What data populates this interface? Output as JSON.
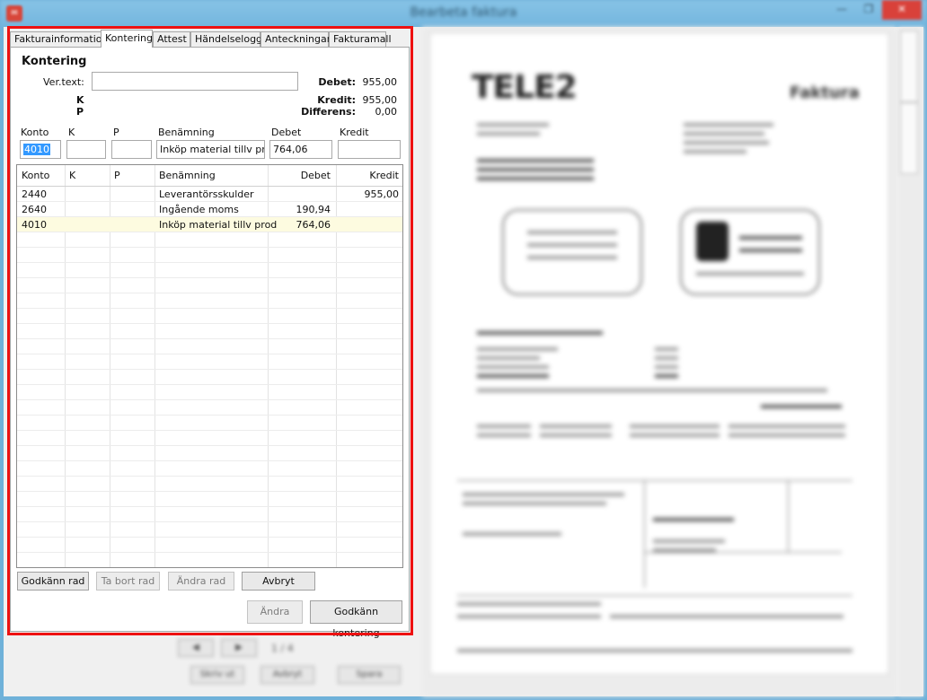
{
  "window": {
    "title": "Bearbeta faktura"
  },
  "tabs": [
    {
      "label": "Fakturainformation"
    },
    {
      "label": "Kontering"
    },
    {
      "label": "Attest"
    },
    {
      "label": "Händelselogg"
    },
    {
      "label": "Anteckningar"
    },
    {
      "label": "Fakturamall"
    }
  ],
  "kontering": {
    "heading": "Kontering",
    "vertext_label": "Ver.text:",
    "vertext_value": "",
    "k_label": "K",
    "p_label": "P",
    "debet_label": "Debet:",
    "debet_value": "955,00",
    "kredit_label": "Kredit:",
    "kredit_value": "955,00",
    "differens_label": "Differens:",
    "differens_value": "0,00"
  },
  "entry": {
    "labels": {
      "konto": "Konto",
      "k": "K",
      "p": "P",
      "benamning": "Benämning",
      "debet": "Debet",
      "kredit": "Kredit"
    },
    "values": {
      "konto": "4010",
      "k": "",
      "p": "",
      "benamning": "Inköp material tillv prod",
      "debet": "764,06",
      "kredit": ""
    }
  },
  "grid": {
    "columns": [
      "Konto",
      "K",
      "P",
      "Benämning",
      "Debet",
      "Kredit"
    ],
    "rows": [
      {
        "konto": "2440",
        "k": "",
        "p": "",
        "benamning": "Leverantörsskulder",
        "debet": "",
        "kredit": "955,00"
      },
      {
        "konto": "2640",
        "k": "",
        "p": "",
        "benamning": "Ingående moms",
        "debet": "190,94",
        "kredit": ""
      },
      {
        "konto": "4010",
        "k": "",
        "p": "",
        "benamning": "Inköp material tillv prod",
        "debet": "764,06",
        "kredit": ""
      }
    ]
  },
  "row_buttons": {
    "approve": "Godkänn rad",
    "delete": "Ta bort rad",
    "change": "Ändra rad",
    "cancel": "Avbryt"
  },
  "bottom_buttons": {
    "change": "Ändra",
    "approve": "Godkänn kontering"
  },
  "preview": {
    "logo": "TELE2",
    "heading": "Faktura"
  },
  "footer": {
    "page": "1 / 4",
    "print": "Skriv ut",
    "cancel": "Avbryt",
    "save": "Spara"
  }
}
